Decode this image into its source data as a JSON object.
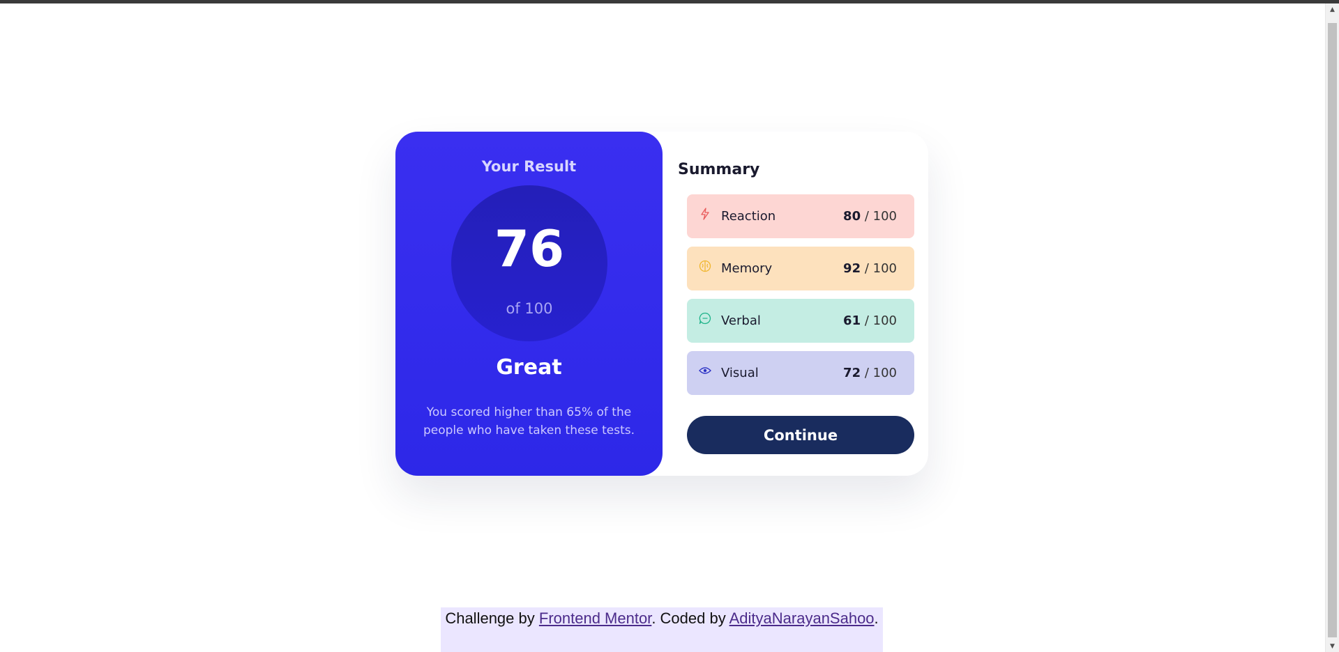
{
  "result": {
    "title": "Your Result",
    "score": "76",
    "score_of": "of 100",
    "rating": "Great",
    "description": "You scored higher than 65% of the people who have taken these tests."
  },
  "summary": {
    "title": "Summary",
    "categories": [
      {
        "label": "Reaction",
        "score": "80",
        "max": "/ 100",
        "icon": "lightning-icon",
        "bg": "#fdd6d3",
        "icon_color": "#e85a5a"
      },
      {
        "label": "Memory",
        "score": "92",
        "max": "/ 100",
        "icon": "brain-icon",
        "bg": "#fde1bd",
        "icon_color": "#f0b62c"
      },
      {
        "label": "Verbal",
        "score": "61",
        "max": "/ 100",
        "icon": "chat-bubble-icon",
        "bg": "#c4ede3",
        "icon_color": "#1fb38a"
      },
      {
        "label": "Visual",
        "score": "72",
        "max": "/ 100",
        "icon": "eye-icon",
        "bg": "#ced0f2",
        "icon_color": "#2b31c4"
      }
    ],
    "continue_label": "Continue"
  },
  "footer": {
    "prefix": "Challenge by ",
    "link1": "Frontend Mentor",
    "middle": ". Coded by ",
    "link2": "AdityaNarayanSahoo",
    "suffix": "."
  },
  "colors": {
    "result_bg": "#2d28e8",
    "button_bg": "#192c5e",
    "footer_bg": "#ebe6ff"
  }
}
